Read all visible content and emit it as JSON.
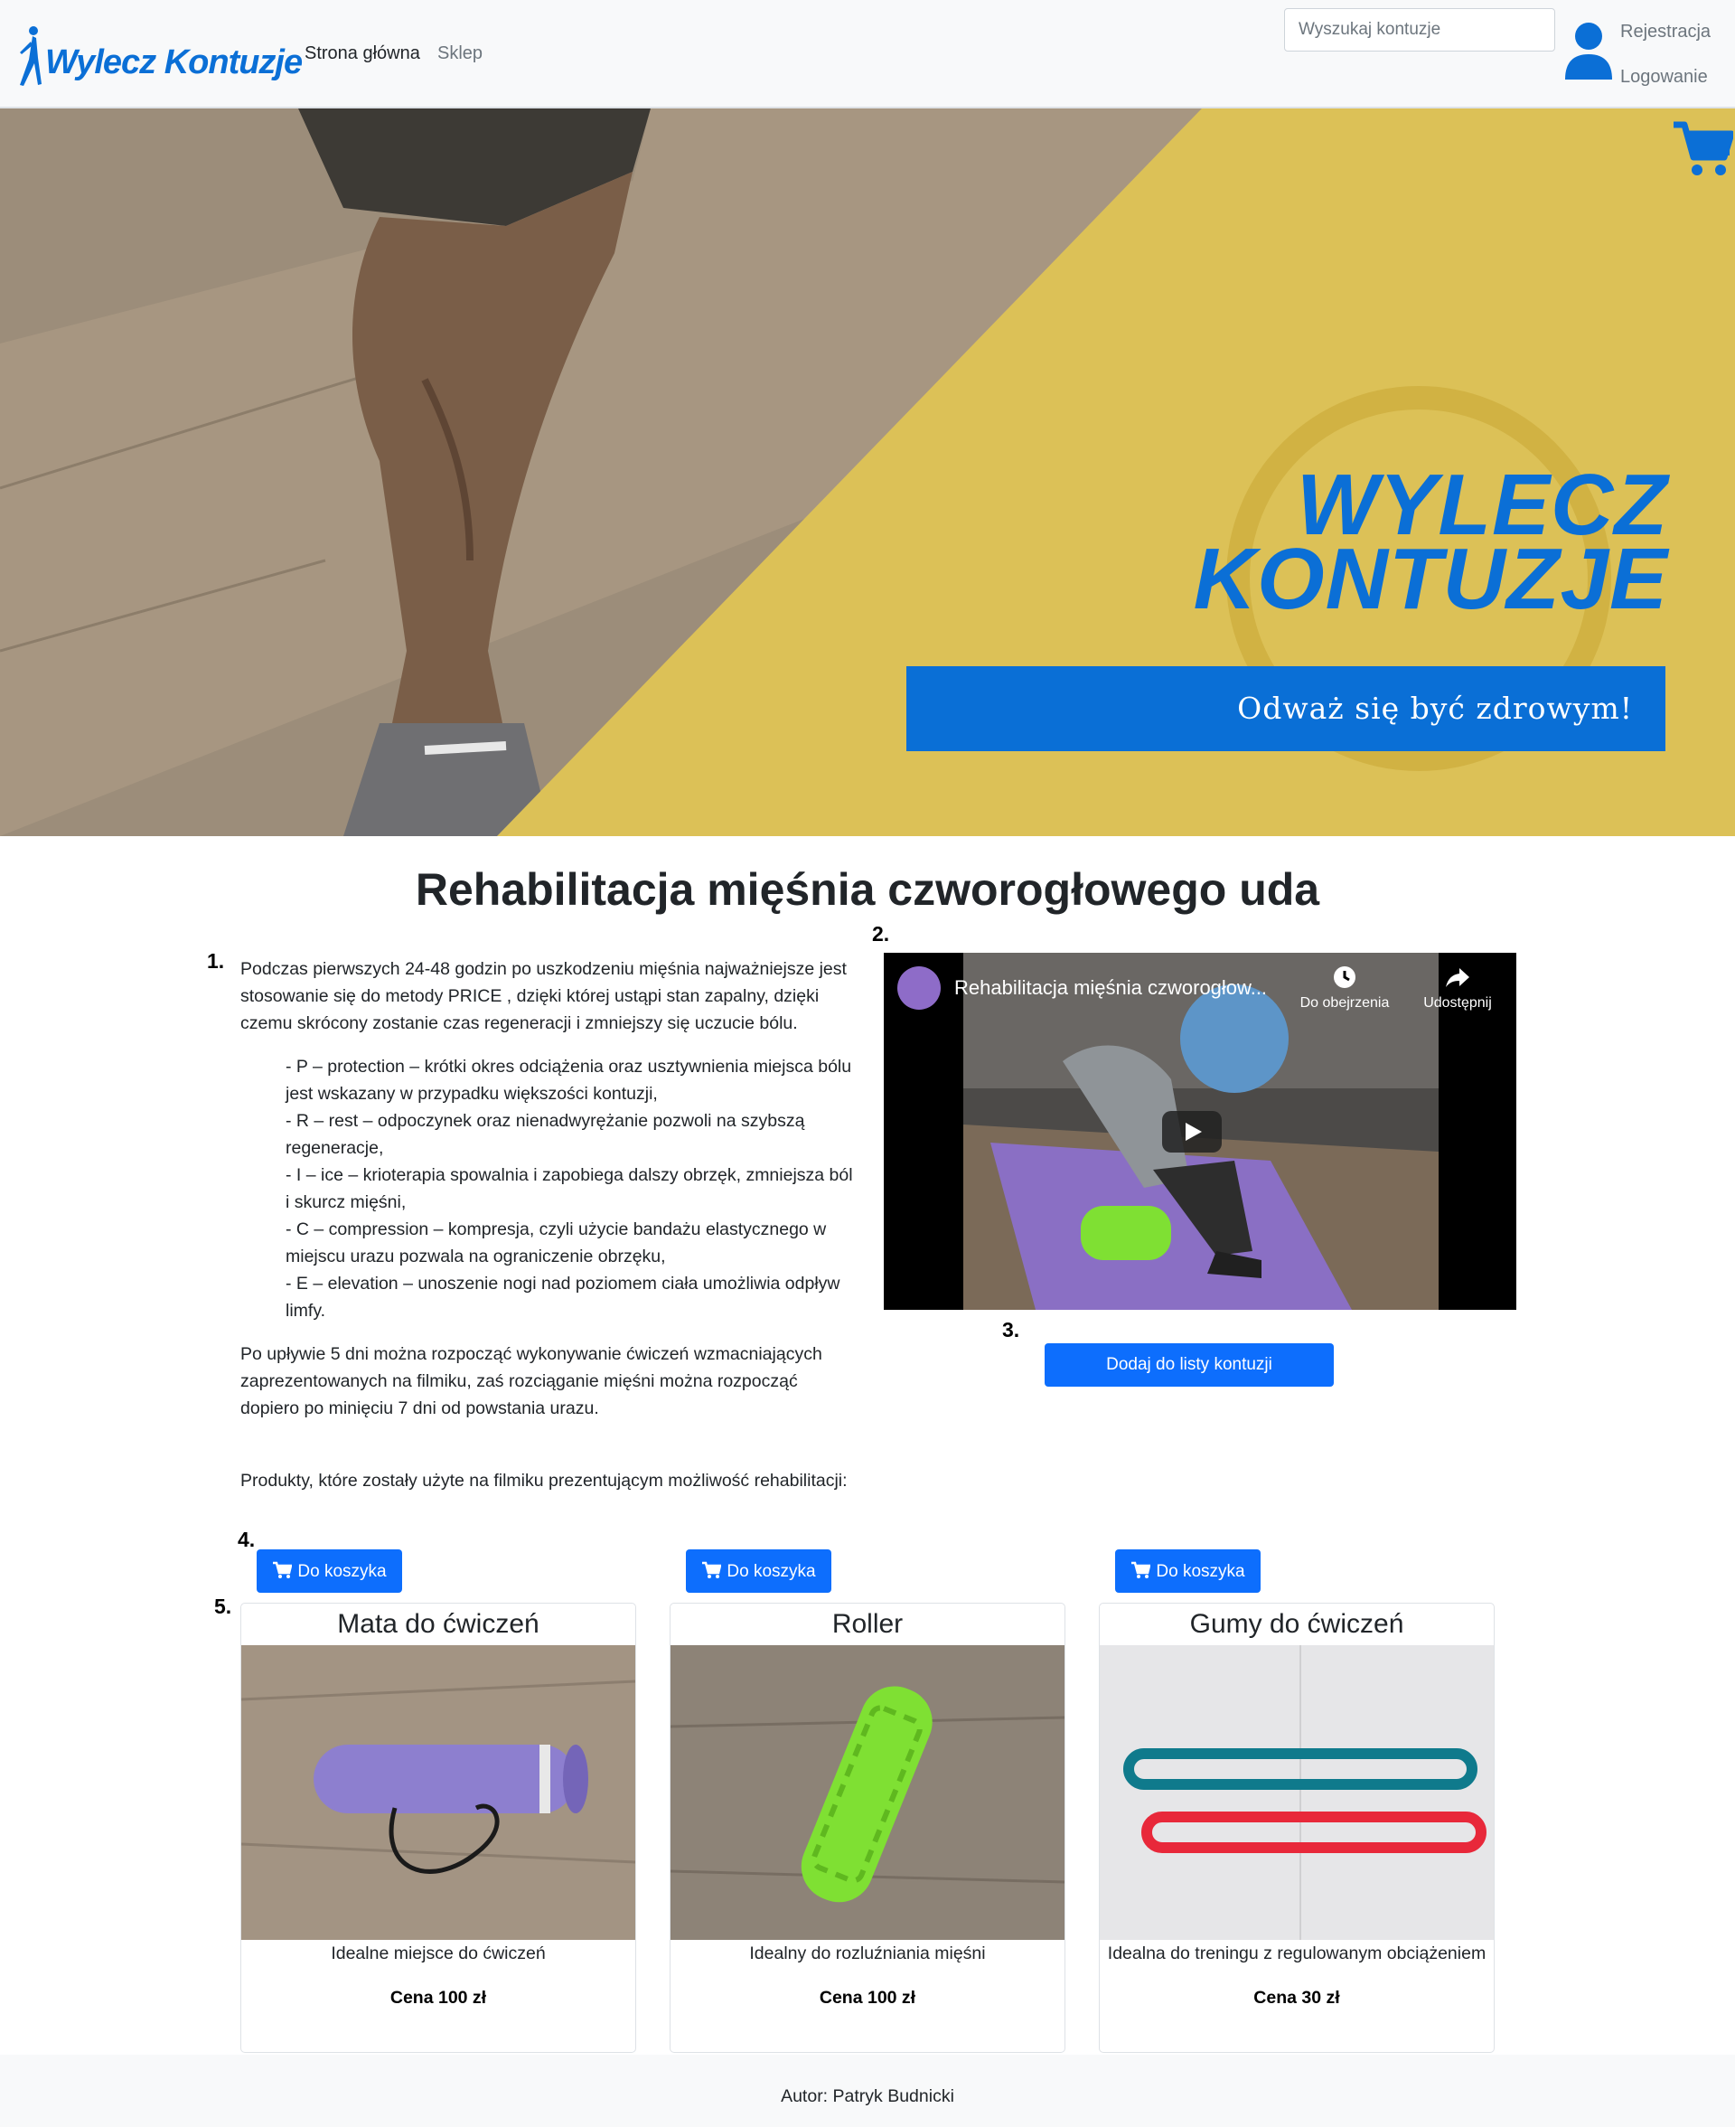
{
  "navbar": {
    "logo_text": "Wylecz Kontuzje",
    "links": [
      {
        "label": "Strona główna"
      },
      {
        "label": "Sklep"
      }
    ],
    "search_placeholder": "Wyszukaj kontuzje",
    "register_label": "Rejestracja",
    "login_label": "Logowanie",
    "icons": [
      "logo-runner-icon",
      "user-icon",
      "cart-icon"
    ]
  },
  "hero": {
    "title_line1": "WYLECZ",
    "title_line2": "KONTUZJE",
    "banner_text": "Odważ się być zdrowym!",
    "colors": {
      "yellow": "#dcc157",
      "blue": "#0a6fd6"
    }
  },
  "main": {
    "title": "Rehabilitacja mięśnia czworogłowego uda",
    "markers": [
      "1.",
      "2.",
      "3.",
      "4.",
      "5."
    ],
    "intro": "Podczas pierwszych 24-48 godzin po uszkodzeniu mięśnia najważniejsze jest stosowanie się do metody PRICE , dzięki której ustąpi stan zapalny, dzięki czemu skrócony zostanie czas regeneracji i zmniejszy się uczucie bólu.",
    "price_items": [
      "- P – protection – krótki okres odciążenia oraz usztywnienia miejsca bólu jest wskazany w przypadku większości kontuzji,",
      "- R – rest – odpoczynek oraz nienadwyrężanie pozwoli na szybszą regeneracje,",
      "- I – ice – krioterapia spowalnia i zapobiega dalszy obrzęk, zmniejsza ból i skurcz mięśni,",
      "- C – compression – kompresja, czyli użycie bandażu elastycznego w miejscu urazu pozwala na ograniczenie obrzęku,",
      "- E – elevation – unoszenie nogi nad poziomem ciała umożliwia odpływ limfy."
    ],
    "after_text": "Po upływie 5 dni można rozpocząć wykonywanie ćwiczeń wzmacniających zaprezentowanych na filmiku, zaś rozciąganie mięśni można rozpocząć dopiero po minięciu 7 dni od powstania urazu.",
    "video": {
      "title": "Rehabilitacja mięśnia czworogłow...",
      "watch_later": "Do obejrzenia",
      "share": "Udostępnij"
    },
    "add_to_list_label": "Dodaj do listy kontuzji",
    "products_intro": "Produkty, które zostały użyte na filmiku prezentującym możliwość rehabilitacji:"
  },
  "products": [
    {
      "cart_label": "Do koszyka",
      "name": "Mata do ćwiczeń",
      "desc": "Idealne miejsce do ćwiczeń",
      "price": "Cena 100 zł"
    },
    {
      "cart_label": "Do koszyka",
      "name": "Roller",
      "desc": "Idealny do rozluźniania mięśni",
      "price": "Cena 100 zł"
    },
    {
      "cart_label": "Do koszyka",
      "name": "Gumy do ćwiczeń",
      "desc": "Idealna do treningu z regulowanym obciążeniem",
      "price": "Cena 30 zł"
    }
  ],
  "footer": {
    "author": "Autor: Patryk Budnicki"
  }
}
